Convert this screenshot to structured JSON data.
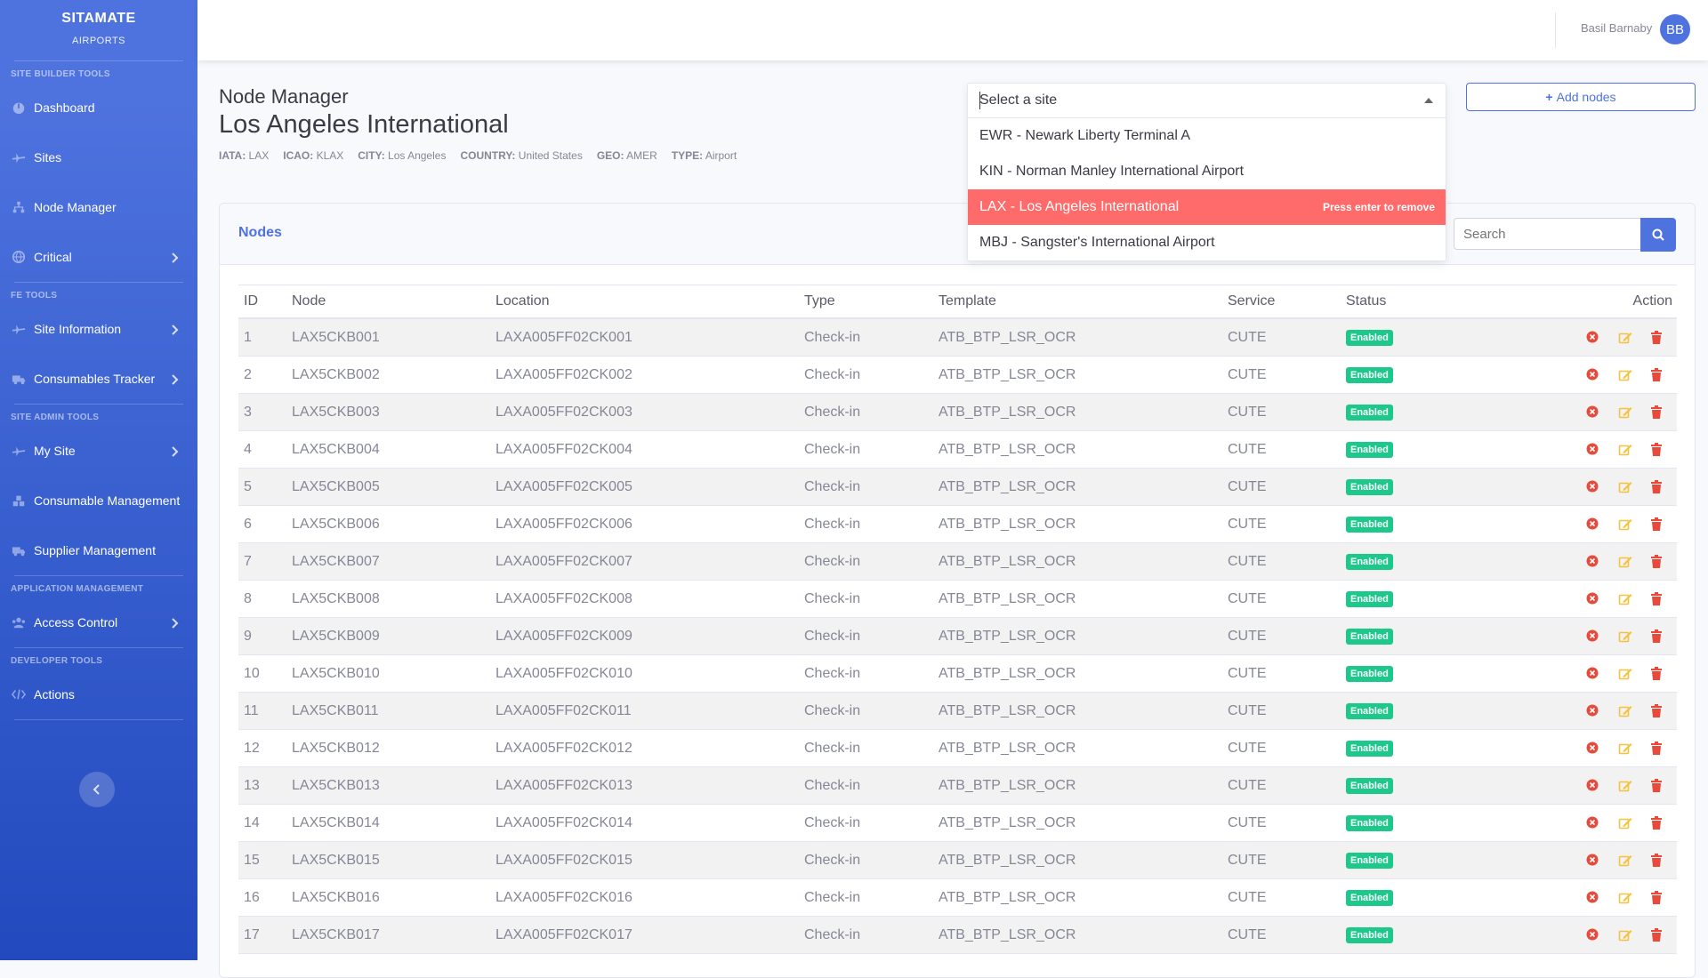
{
  "sidebar": {
    "brand": "SITAMATE",
    "brand_sub": "AIRPORTS",
    "sections": [
      {
        "heading": "SITE BUILDER TOOLS",
        "items": [
          {
            "label": "Dashboard",
            "icon": "dashboard-icon",
            "chevron": false
          },
          {
            "label": "Sites",
            "icon": "plane-icon",
            "chevron": false
          },
          {
            "label": "Node Manager",
            "icon": "sitemap-icon",
            "chevron": false
          },
          {
            "label": "Critical",
            "icon": "globe-icon",
            "chevron": true
          }
        ]
      },
      {
        "heading": "FE TOOLS",
        "items": [
          {
            "label": "Site Information",
            "icon": "plane-icon",
            "chevron": true
          },
          {
            "label": "Consumables Tracker",
            "icon": "truck-icon",
            "chevron": true
          }
        ]
      },
      {
        "heading": "SITE ADMIN TOOLS",
        "items": [
          {
            "label": "My Site",
            "icon": "plane-icon",
            "chevron": true
          },
          {
            "label": "Consumable Management",
            "icon": "boxes-icon",
            "chevron": false
          },
          {
            "label": "Supplier Management",
            "icon": "truck-icon",
            "chevron": false
          }
        ]
      },
      {
        "heading": "APPLICATION MANAGEMENT",
        "items": [
          {
            "label": "Access Control",
            "icon": "users-icon",
            "chevron": true
          }
        ]
      },
      {
        "heading": "DEVELOPER TOOLS",
        "items": [
          {
            "label": "Actions",
            "icon": "code-icon",
            "chevron": false
          }
        ]
      }
    ]
  },
  "topbar": {
    "user_name": "Basil Barnaby",
    "avatar_initials": "BB"
  },
  "header": {
    "kicker": "Node Manager",
    "title": "Los Angeles International",
    "meta": [
      {
        "key": "IATA:",
        "value": "LAX"
      },
      {
        "key": "ICAO:",
        "value": "KLAX"
      },
      {
        "key": "CITY:",
        "value": "Los Angeles"
      },
      {
        "key": "COUNTRY:",
        "value": "United States"
      },
      {
        "key": "GEO:",
        "value": "AMER"
      },
      {
        "key": "TYPE:",
        "value": "Airport"
      }
    ],
    "add_button": "Add nodes"
  },
  "site_select": {
    "placeholder": "Select a site",
    "options": [
      {
        "label": "EWR - Newark Liberty Terminal A",
        "selected": false
      },
      {
        "label": "KIN - Norman Manley International Airport",
        "selected": false
      },
      {
        "label": "LAX - Los Angeles International",
        "selected": true
      },
      {
        "label": "MBJ - Sangster's International Airport",
        "selected": false
      }
    ],
    "remove_hint": "Press enter to remove"
  },
  "nodes_card": {
    "title": "Nodes",
    "search_placeholder": "Search",
    "columns": [
      "ID",
      "Node",
      "Location",
      "Type",
      "Template",
      "Service",
      "Status",
      "Action"
    ],
    "rows": [
      {
        "id": "1",
        "node": "LAX5CKB001",
        "location": "LAXA005FF02CK001",
        "type": "Check-in",
        "template": "ATB_BTP_LSR_OCR",
        "service": "CUTE",
        "status": "Enabled"
      },
      {
        "id": "2",
        "node": "LAX5CKB002",
        "location": "LAXA005FF02CK002",
        "type": "Check-in",
        "template": "ATB_BTP_LSR_OCR",
        "service": "CUTE",
        "status": "Enabled"
      },
      {
        "id": "3",
        "node": "LAX5CKB003",
        "location": "LAXA005FF02CK003",
        "type": "Check-in",
        "template": "ATB_BTP_LSR_OCR",
        "service": "CUTE",
        "status": "Enabled"
      },
      {
        "id": "4",
        "node": "LAX5CKB004",
        "location": "LAXA005FF02CK004",
        "type": "Check-in",
        "template": "ATB_BTP_LSR_OCR",
        "service": "CUTE",
        "status": "Enabled"
      },
      {
        "id": "5",
        "node": "LAX5CKB005",
        "location": "LAXA005FF02CK005",
        "type": "Check-in",
        "template": "ATB_BTP_LSR_OCR",
        "service": "CUTE",
        "status": "Enabled"
      },
      {
        "id": "6",
        "node": "LAX5CKB006",
        "location": "LAXA005FF02CK006",
        "type": "Check-in",
        "template": "ATB_BTP_LSR_OCR",
        "service": "CUTE",
        "status": "Enabled"
      },
      {
        "id": "7",
        "node": "LAX5CKB007",
        "location": "LAXA005FF02CK007",
        "type": "Check-in",
        "template": "ATB_BTP_LSR_OCR",
        "service": "CUTE",
        "status": "Enabled"
      },
      {
        "id": "8",
        "node": "LAX5CKB008",
        "location": "LAXA005FF02CK008",
        "type": "Check-in",
        "template": "ATB_BTP_LSR_OCR",
        "service": "CUTE",
        "status": "Enabled"
      },
      {
        "id": "9",
        "node": "LAX5CKB009",
        "location": "LAXA005FF02CK009",
        "type": "Check-in",
        "template": "ATB_BTP_LSR_OCR",
        "service": "CUTE",
        "status": "Enabled"
      },
      {
        "id": "10",
        "node": "LAX5CKB010",
        "location": "LAXA005FF02CK010",
        "type": "Check-in",
        "template": "ATB_BTP_LSR_OCR",
        "service": "CUTE",
        "status": "Enabled"
      },
      {
        "id": "11",
        "node": "LAX5CKB011",
        "location": "LAXA005FF02CK011",
        "type": "Check-in",
        "template": "ATB_BTP_LSR_OCR",
        "service": "CUTE",
        "status": "Enabled"
      },
      {
        "id": "12",
        "node": "LAX5CKB012",
        "location": "LAXA005FF02CK012",
        "type": "Check-in",
        "template": "ATB_BTP_LSR_OCR",
        "service": "CUTE",
        "status": "Enabled"
      },
      {
        "id": "13",
        "node": "LAX5CKB013",
        "location": "LAXA005FF02CK013",
        "type": "Check-in",
        "template": "ATB_BTP_LSR_OCR",
        "service": "CUTE",
        "status": "Enabled"
      },
      {
        "id": "14",
        "node": "LAX5CKB014",
        "location": "LAXA005FF02CK014",
        "type": "Check-in",
        "template": "ATB_BTP_LSR_OCR",
        "service": "CUTE",
        "status": "Enabled"
      },
      {
        "id": "15",
        "node": "LAX5CKB015",
        "location": "LAXA005FF02CK015",
        "type": "Check-in",
        "template": "ATB_BTP_LSR_OCR",
        "service": "CUTE",
        "status": "Enabled"
      },
      {
        "id": "16",
        "node": "LAX5CKB016",
        "location": "LAXA005FF02CK016",
        "type": "Check-in",
        "template": "ATB_BTP_LSR_OCR",
        "service": "CUTE",
        "status": "Enabled"
      },
      {
        "id": "17",
        "node": "LAX5CKB017",
        "location": "LAXA005FF02CK017",
        "type": "Check-in",
        "template": "ATB_BTP_LSR_OCR",
        "service": "CUTE",
        "status": "Enabled"
      }
    ]
  },
  "colors": {
    "primary": "#4e73df",
    "enabled": "#1cc88a",
    "selected_option": "#ff6a6a",
    "danger": "#e74a3b",
    "warning": "#f6c23e"
  }
}
